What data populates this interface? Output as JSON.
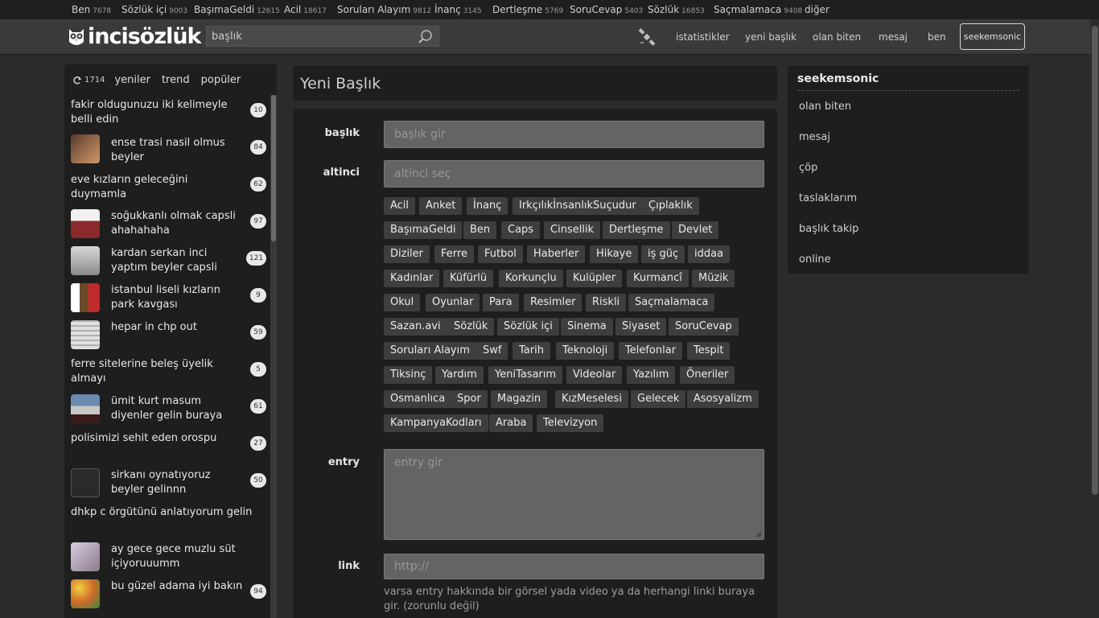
{
  "channels": [
    {
      "name": "Ben",
      "count": "7678"
    },
    {
      "name": "Sözlük içi",
      "count": "9003"
    },
    {
      "name": "BaşımaGeldi",
      "count": "12615"
    },
    {
      "name": "Acil",
      "count": "18617"
    },
    {
      "name": "Soruları Alayım",
      "count": "9812"
    },
    {
      "name": "İnanç",
      "count": "3145"
    },
    {
      "name": "Dertleşme",
      "count": "5769"
    },
    {
      "name": "SoruCevap",
      "count": "5403"
    },
    {
      "name": "Sözlük",
      "count": "16853"
    },
    {
      "name": "Saçmalamaca",
      "count": "9408"
    },
    {
      "name": "diğer",
      "count": ""
    }
  ],
  "header": {
    "logo": "incisözlük",
    "search_placeholder": "başlık",
    "nav": [
      "istatistikler",
      "yeni başlık",
      "olan biten",
      "mesaj",
      "ben"
    ],
    "user": "seekemsonic"
  },
  "left": {
    "count": "1714",
    "links": [
      "yeniler",
      "trend",
      "popüler"
    ],
    "topics": [
      {
        "title": "fakir oldugunuzu iki kelimeyle belli edin",
        "count": "10",
        "thumb": ""
      },
      {
        "title": "ense trasi nasil olmus beyler",
        "count": "84",
        "thumb": "#9b6a45"
      },
      {
        "title": "eve kızların geleceğini duymamla",
        "count": "62",
        "thumb": ""
      },
      {
        "title": "soğukkanlı olmak capsli ahahahaha",
        "count": "97",
        "thumb": "#8a2a2a"
      },
      {
        "title": "kardan serkan inci yaptım beyler capsli",
        "count": "121",
        "thumb": "#b9b9b9"
      },
      {
        "title": "istanbul liseli kızların park kavgası",
        "count": "9",
        "thumb": "#6b4a2a"
      },
      {
        "title": "hepar in chp out",
        "count": "59",
        "thumb": "#cfcfcf"
      },
      {
        "title": "ferre sitelerine beleş üyelik almayı",
        "count": "5",
        "thumb": ""
      },
      {
        "title": "ümit kurt masum diyenler gelin buraya",
        "count": "61",
        "thumb": "#8a5a3a"
      },
      {
        "title": "polisimizi sehit eden orospu",
        "count": "27",
        "thumb": ""
      },
      {
        "title": "sirkanı oynatıyoruz beyler gelinnn",
        "count": "50",
        "thumb": "#2a2a2a"
      },
      {
        "title": "dhkp c örgütünü anlatıyorum gelin",
        "count": "",
        "thumb": ""
      },
      {
        "title": "ay gece gece muzlu süt içiyoruuumm",
        "count": "",
        "thumb": "#b4a8b8"
      },
      {
        "title": "bu güzel adama iyi bakın",
        "count": "94",
        "thumb": "#d89a3a"
      }
    ]
  },
  "center": {
    "page_title": "Yeni Başlık",
    "labels": {
      "title": "başlık",
      "channel": "altinci",
      "entry": "entry",
      "link": "link"
    },
    "placeholders": {
      "title": "başlık gir",
      "channel": "altinci seç",
      "entry": "entry gir",
      "link": "http://"
    },
    "tags": [
      "Acil",
      "Anket",
      "İnanç",
      "IrkçılıkİnsanlıkSuçudur",
      "Çıplaklık",
      "BaşımaGeldi",
      "Ben",
      "Caps",
      "Cinsellik",
      "Dertleşme",
      "Devlet",
      "Diziler",
      "Ferre",
      "Futbol",
      "Haberler",
      "Hikaye",
      "iş güç",
      "iddaa",
      "Kadınlar",
      "Küfürlü",
      "Korkunçlu",
      "Kulüpler",
      "Kurmancî",
      "Müzik",
      "Okul",
      "Oyunlar",
      "Para",
      "Resimler",
      "Riskli",
      "Saçmalamaca",
      "Sazan.avi",
      "Sözlük",
      "Sözlük içi",
      "Sinema",
      "Siyaset",
      "SoruCevap",
      "Soruları Alayım",
      "Swf",
      "Tarih",
      "Teknoloji",
      "Telefonlar",
      "Tespit",
      "Tiksinç",
      "Yardım",
      "YeniTasarım",
      "Videolar",
      "Yazılım",
      "Öneriler",
      "Osmanlıca",
      "Spor",
      "Magazin",
      "KızMeselesi",
      "Gelecek",
      "Asosyalizm",
      "KampanyaKodları",
      "Araba",
      "Televizyon"
    ],
    "hint": "varsa entry hakkında bir görsel yada video ya da herhangi linki buraya gir. (zorunlu değil)"
  },
  "right": {
    "username": "seekemsonic",
    "items": [
      "olan biten",
      "mesaj",
      "çöp",
      "taslaklarım",
      "başlık takip",
      "online"
    ]
  }
}
